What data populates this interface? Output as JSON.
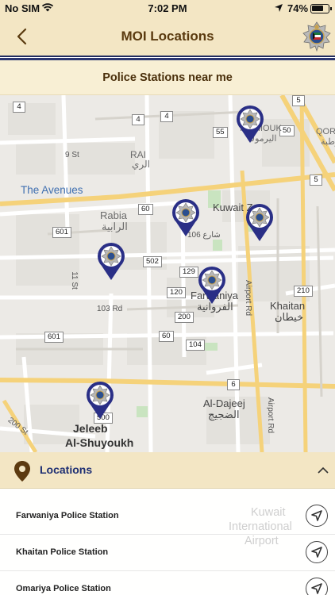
{
  "status": {
    "carrier": "No SIM",
    "time": "7:02 PM",
    "battery": "74%",
    "battery_level": 0.74
  },
  "header": {
    "title": "MOI Locations"
  },
  "subheader": {
    "text": "Police Stations near me"
  },
  "map": {
    "labels": {
      "the_avenues": "The Avenues",
      "rabia_en": "Rabia",
      "rabia_ar": "الرابية",
      "farwaniya_en": "Farwaniya",
      "farwaniya_ar": "الفروانية",
      "khaitan_en": "Khaitan",
      "khaitan_ar": "خيطان",
      "al_dajeej_en": "Al-Dajeej",
      "al_dajeej_ar": "الضجيج",
      "jeleeb_1": "Jeleeb",
      "jeleeb_2": "Al-Shuyoukh",
      "rai_en": "RAI",
      "rai_ar": "الري",
      "kuwait_zoo": "Kuwait Zoo",
      "yarmouk": "YARMOUK",
      "yarmouk_ar": "اليرموك",
      "qortuba": "QORT",
      "qortuba_ar": "قرطبة",
      "st_9": "9 St",
      "rd_103": "103 Rd",
      "st_11": "11 St",
      "st_200": "200 St",
      "airport_rd_1": "Airport Rd",
      "airport_rd_2": "Airport Rd",
      "street_106": "شارع 106",
      "road_5": "5"
    },
    "shields": [
      "4",
      "4",
      "4",
      "55",
      "50",
      "5",
      "5",
      "60",
      "601",
      "502",
      "129",
      "120",
      "210",
      "200",
      "601",
      "60",
      "104",
      "6",
      "500",
      "60"
    ]
  },
  "locations": {
    "title": "Locations",
    "items": [
      {
        "name": "Farwaniya Police Station"
      },
      {
        "name": "Khaitan Police Station"
      },
      {
        "name": "Omariya Police Station"
      }
    ],
    "background_text": {
      "line1": "Kuwait",
      "line2": "International",
      "line3": "Airport"
    }
  },
  "colors": {
    "header_bg": "#f3e6c4",
    "title_text": "#5a3a0f",
    "pin": "#2a2f86",
    "locations_title": "#1e2f73",
    "pin_icon": "#5c3a10"
  },
  "icons": {
    "back": "chevron-left-icon",
    "emblem": "kuwait-police-emblem-icon",
    "pin": "police-map-pin-icon",
    "location": "location-pin-icon",
    "collapse": "chevron-up-icon",
    "navigate": "navigation-arrow-icon"
  }
}
